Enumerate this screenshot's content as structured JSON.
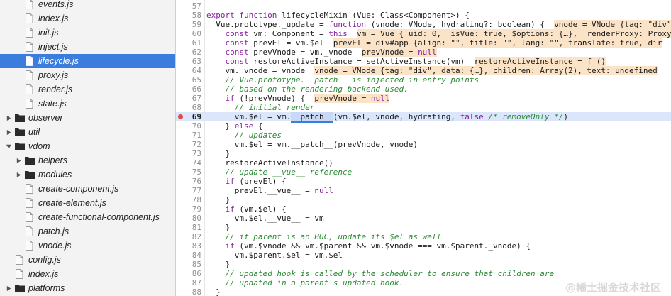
{
  "file_tree": [
    {
      "label": "events.js",
      "type": "file",
      "depth": 1
    },
    {
      "label": "index.js",
      "type": "file",
      "depth": 1
    },
    {
      "label": "init.js",
      "type": "file",
      "depth": 1
    },
    {
      "label": "inject.js",
      "type": "file",
      "depth": 1
    },
    {
      "label": "lifecycle.js",
      "type": "file",
      "depth": 1,
      "selected": true
    },
    {
      "label": "proxy.js",
      "type": "file",
      "depth": 1
    },
    {
      "label": "render.js",
      "type": "file",
      "depth": 1
    },
    {
      "label": "state.js",
      "type": "file",
      "depth": 1
    },
    {
      "label": "observer",
      "type": "folder",
      "depth": 0,
      "expanded": false
    },
    {
      "label": "util",
      "type": "folder",
      "depth": 0,
      "expanded": false
    },
    {
      "label": "vdom",
      "type": "folder",
      "depth": 0,
      "expanded": true
    },
    {
      "label": "helpers",
      "type": "folder",
      "depth": 1,
      "expanded": false
    },
    {
      "label": "modules",
      "type": "folder",
      "depth": 1,
      "expanded": false
    },
    {
      "label": "create-component.js",
      "type": "file",
      "depth": 1
    },
    {
      "label": "create-element.js",
      "type": "file",
      "depth": 1
    },
    {
      "label": "create-functional-component.js",
      "type": "file",
      "depth": 1
    },
    {
      "label": "patch.js",
      "type": "file",
      "depth": 1
    },
    {
      "label": "vnode.js",
      "type": "file",
      "depth": 1
    },
    {
      "label": "config.js",
      "type": "file",
      "depth": 0
    },
    {
      "label": "index.js",
      "type": "file",
      "depth": 0
    },
    {
      "label": "platforms",
      "type": "folder",
      "depth": 0,
      "expanded": false
    }
  ],
  "editor": {
    "breakpoint_line": 69,
    "lines": [
      {
        "n": "57",
        "code": ""
      },
      {
        "n": "58",
        "code": "export function lifecycleMixin (Vue: Class<Component>) {"
      },
      {
        "n": "59",
        "code": "  Vue.prototype._update = function (vnode: VNode, hydrating?: boolean) {  vnode = VNode {tag: \"div\", data: {…}"
      },
      {
        "n": "60",
        "code": "    const vm: Component = this  vm = Vue {_uid: 0, _isVue: true, $options: {…}, _renderProxy: Proxy"
      },
      {
        "n": "61",
        "code": "    const prevEl = vm.$el  prevEl = div#app {align: \"\", title: \"\", lang: \"\", translate: true, dir"
      },
      {
        "n": "62",
        "code": "    const prevVnode = vm._vnode  prevVnode = null"
      },
      {
        "n": "63",
        "code": "    const restoreActiveInstance = setActiveInstance(vm)  restoreActiveInstance = ƒ ()"
      },
      {
        "n": "64",
        "code": "    vm._vnode = vnode  vnode = VNode {tag: \"div\", data: {…}, children: Array(2), text: undefined"
      },
      {
        "n": "65",
        "code": "    // Vue.prototype.__patch__ is injected in entry points"
      },
      {
        "n": "66",
        "code": "    // based on the rendering backend used."
      },
      {
        "n": "67",
        "code": "    if (!prevVnode) {  prevVnode = null"
      },
      {
        "n": "68",
        "code": "      // initial render"
      },
      {
        "n": "69",
        "code": "      vm.$el = vm.__patch__(vm.$el, vnode, hydrating, false /* removeOnly */)"
      },
      {
        "n": "70",
        "code": "    } else {"
      },
      {
        "n": "71",
        "code": "      // updates"
      },
      {
        "n": "72",
        "code": "      vm.$el = vm.__patch__(prevVnode, vnode)"
      },
      {
        "n": "73",
        "code": "    }"
      },
      {
        "n": "74",
        "code": "    restoreActiveInstance()"
      },
      {
        "n": "75",
        "code": "    // update __vue__ reference"
      },
      {
        "n": "76",
        "code": "    if (prevEl) {"
      },
      {
        "n": "77",
        "code": "      prevEl.__vue__ = null"
      },
      {
        "n": "78",
        "code": "    }"
      },
      {
        "n": "79",
        "code": "    if (vm.$el) {"
      },
      {
        "n": "80",
        "code": "      vm.$el.__vue__ = vm"
      },
      {
        "n": "81",
        "code": "    }"
      },
      {
        "n": "82",
        "code": "    // if parent is an HOC, update its $el as well"
      },
      {
        "n": "83",
        "code": "    if (vm.$vnode && vm.$parent && vm.$vnode === vm.$parent._vnode) {"
      },
      {
        "n": "84",
        "code": "      vm.$parent.$el = vm.$el"
      },
      {
        "n": "85",
        "code": "    }"
      },
      {
        "n": "86",
        "code": "    // updated hook is called by the scheduler to ensure that children are"
      },
      {
        "n": "87",
        "code": "    // updated in a parent's updated hook."
      },
      {
        "n": "88",
        "code": "  }"
      }
    ]
  },
  "watermark": "@稀土掘金技术社区",
  "colors": {
    "selected_bg": "#3b7ddc",
    "paused_line_bg": "#dbe6fb",
    "breakpoint": "#e24a45",
    "inline_value_bg": "#fae3c6",
    "comment": "#2c8a35",
    "keyword": "#8a1fa0"
  }
}
